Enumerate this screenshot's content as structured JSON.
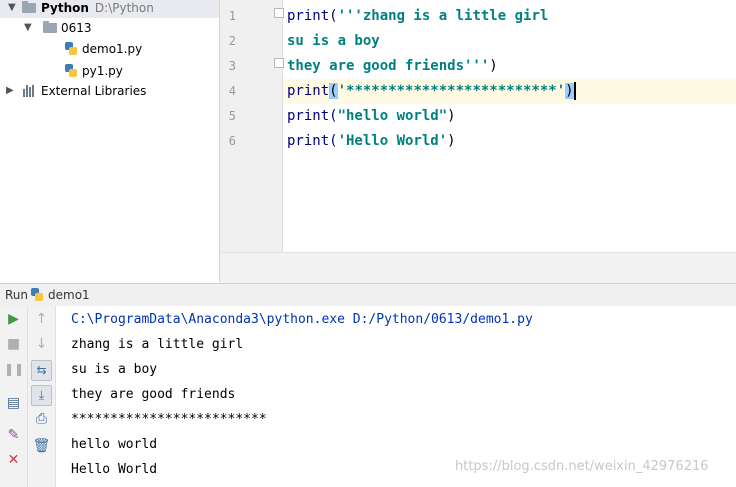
{
  "project": {
    "root": {
      "name": "Python",
      "path": "D:\\Python"
    },
    "folder": "0613",
    "files": [
      "demo1.py",
      "py1.py"
    ],
    "external": "External Libraries"
  },
  "editor": {
    "line_numbers": [
      "1",
      "2",
      "3",
      "4",
      "5",
      "6"
    ],
    "lines": [
      [
        {
          "t": "print(",
          "c": "kw"
        },
        {
          "t": "'''zhang is a little girl",
          "c": "str"
        }
      ],
      [
        {
          "t": "su is a boy",
          "c": "str"
        }
      ],
      [
        {
          "t": "they are good friends'''",
          "c": "str"
        },
        {
          "t": ")",
          "c": "paren"
        }
      ],
      [
        {
          "t": "print",
          "c": "kw"
        },
        {
          "t": "(",
          "c": "hl"
        },
        {
          "t": "'*************************'",
          "c": "str"
        },
        {
          "t": ")",
          "c": "hl"
        }
      ],
      [
        {
          "t": "print(",
          "c": "kw"
        },
        {
          "t": "\"hello world\"",
          "c": "str"
        },
        {
          "t": ")",
          "c": "paren"
        }
      ],
      [
        {
          "t": "print(",
          "c": "kw"
        },
        {
          "t": "'Hello World'",
          "c": "str"
        },
        {
          "t": ")",
          "c": "paren"
        }
      ]
    ]
  },
  "run": {
    "label": "Run",
    "config": "demo1",
    "output": [
      "C:\\ProgramData\\Anaconda3\\python.exe D:/Python/0613/demo1.py",
      "zhang is a little girl",
      "su is a boy",
      "they are good friends",
      "*************************",
      "hello world",
      "Hello World"
    ]
  },
  "watermark": "https://blog.csdn.net/weixin_42976216",
  "colors": {
    "keyword": "#000080",
    "string": "#008080",
    "current_line": "#fffae3",
    "command": "#0033b3"
  }
}
